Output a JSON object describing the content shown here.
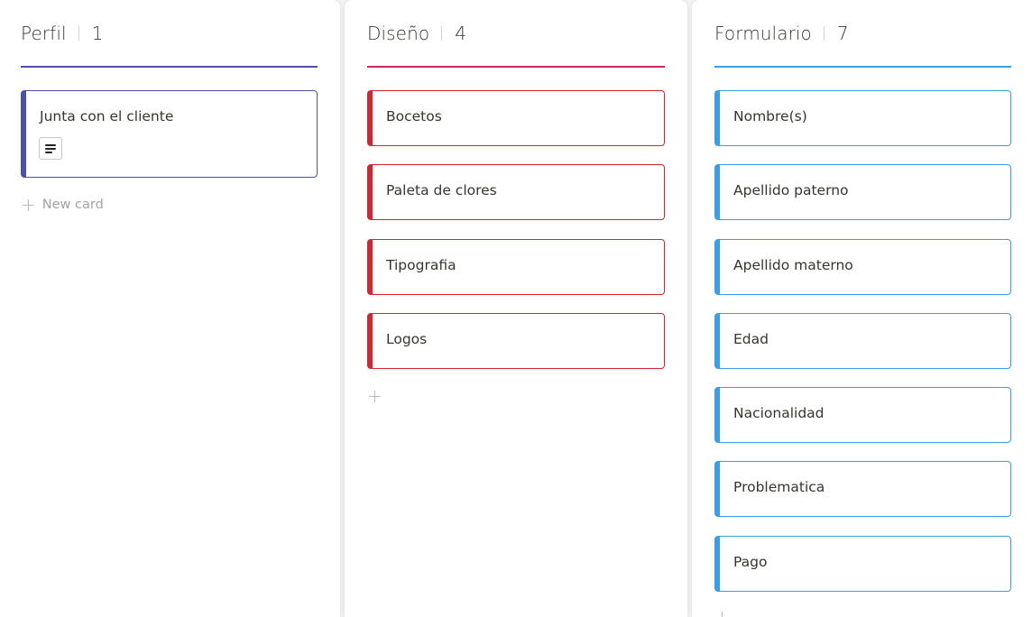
{
  "colors": {
    "perfil": "#4a4fb3",
    "diseno": "#d7242f",
    "diseno_rule": "#d12660",
    "formulario": "#3a9ee8"
  },
  "columns": [
    {
      "name": "Perfil",
      "count": "1",
      "cards": [
        "Junta con el cliente"
      ],
      "new_card_label": "New card"
    },
    {
      "name": "Diseño",
      "count": "4",
      "cards": [
        "Bocetos",
        "Paleta de clores",
        "Tipografia",
        "Logos"
      ]
    },
    {
      "name": "Formulario",
      "count": "7",
      "cards": [
        "Nombre(s)",
        "Apellido paterno",
        "Apellido materno",
        "Edad",
        "Nacionalidad",
        "Problematica",
        "Pago"
      ]
    }
  ]
}
